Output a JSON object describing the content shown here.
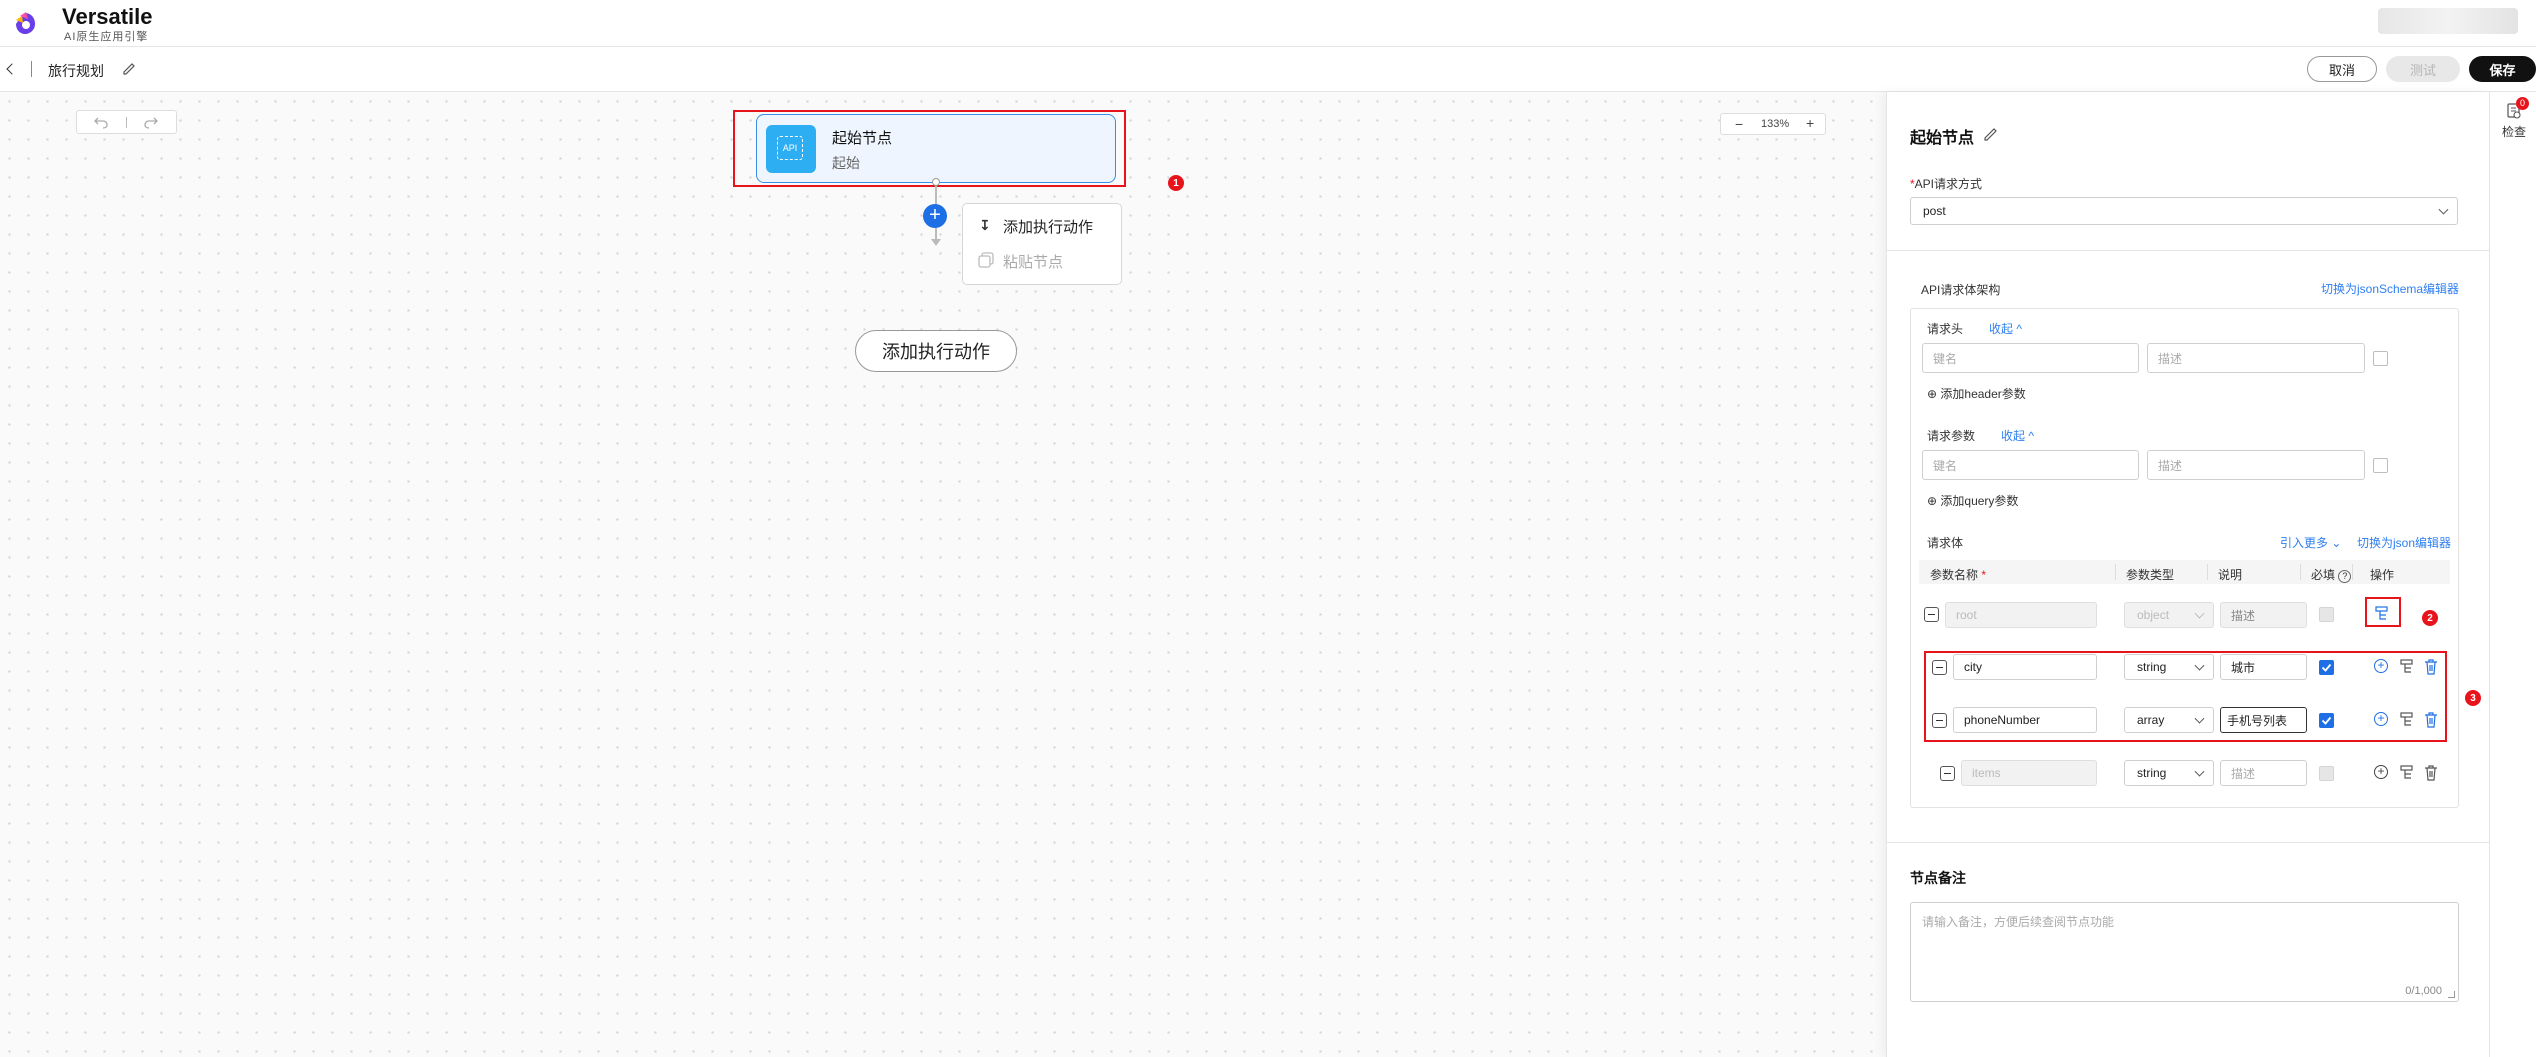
{
  "app": {
    "name": "Versatile",
    "subtitle": "AI原生应用引擎"
  },
  "header": {
    "title": "旅行规划",
    "cancel_label": "取消",
    "test_label": "测试",
    "save_label": "保存"
  },
  "canvas": {
    "zoom": "133%",
    "start_node": {
      "title": "起始节点",
      "subtitle": "起始",
      "icon_text": "API"
    },
    "menu": {
      "add_action": "添加执行动作",
      "paste_node": "粘贴节点"
    },
    "add_action_button": "添加执行动作"
  },
  "panel": {
    "title": "起始节点",
    "api_method_label": "API请求方式",
    "api_method_value": "post",
    "schema_label": "API请求体架构",
    "switch_schema_link": "切换为jsonSchema编辑器",
    "headers": {
      "label": "请求头",
      "collapse": "收起",
      "key_placeholder": "键名",
      "desc_placeholder": "描述",
      "add_label": "添加header参数"
    },
    "query": {
      "label": "请求参数",
      "collapse": "收起",
      "key_placeholder": "键名",
      "desc_placeholder": "描述",
      "add_label": "添加query参数"
    },
    "body": {
      "label": "请求体",
      "import_more": "引入更多",
      "switch_json": "切换为json编辑器",
      "columns": {
        "name": "参数名称",
        "type": "参数类型",
        "desc": "说明",
        "required": "必填",
        "ops": "操作"
      },
      "rows": [
        {
          "name": "root",
          "type": "object",
          "desc": "描述"
        },
        {
          "name": "city",
          "type": "string",
          "desc": "城市"
        },
        {
          "name": "phoneNumber",
          "type": "array",
          "desc": "手机号列表"
        },
        {
          "name": "items",
          "type": "string",
          "desc": "描述"
        }
      ]
    },
    "notes": {
      "label": "节点备注",
      "placeholder": "请输入备注，方便后续查阅节点功能",
      "counter": "0/1,000"
    }
  },
  "sidebar": {
    "check_label": "检查",
    "badge": "0"
  },
  "annotations": [
    "1",
    "2",
    "3"
  ]
}
